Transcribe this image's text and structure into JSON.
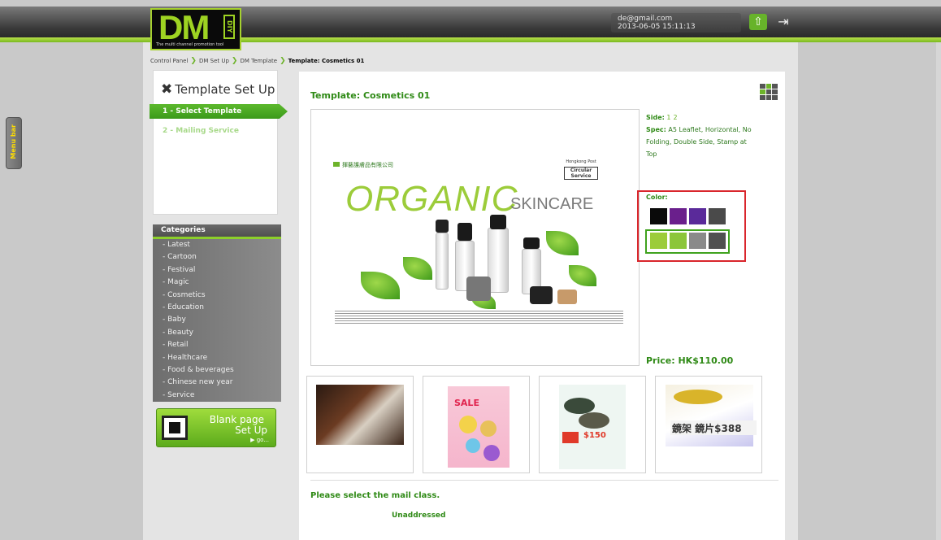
{
  "header": {
    "logo_main": "DM",
    "logo_sub": "DIY",
    "logo_tagline": "The multi channel promotion tool",
    "user_email": "de@gmail.com",
    "user_datetime": "2013-06-05 15:11:13",
    "home_icon": "up-arrow-icon",
    "logout_icon": "logout-icon"
  },
  "side_tab": {
    "label": "Menu bar"
  },
  "breadcrumb": [
    "Control Panel",
    "DM Set Up",
    "DM Template",
    "Template: Cosmetics 01"
  ],
  "setup": {
    "title": "Template Set Up",
    "icon": "tools-icon",
    "steps": [
      "1 - Select Template",
      "2 - Mailing Service"
    ]
  },
  "categories": {
    "title": "Categories",
    "items": [
      "Latest",
      "Cartoon",
      "Festival",
      "Magic",
      "Cosmetics",
      "Education",
      "Baby",
      "Beauty",
      "Retail",
      "Healthcare",
      "Food & beverages",
      "Chinese new year",
      "Service"
    ]
  },
  "blank_page": {
    "line1": "Blank page",
    "line2": "Set Up",
    "go": "go..."
  },
  "template": {
    "title": "Template: Cosmetics 01",
    "preview": {
      "company": "揮藝護膚品有限公司",
      "hkpost_top": "Hongkong Post",
      "hkpost_box": "Circular Service",
      "headline": "ORGANIC",
      "headline_sub": "SKINCARE"
    },
    "side_label": "Side:",
    "sides": [
      "1",
      "2"
    ],
    "spec_label": "Spec:",
    "spec_text": "A5 Leaflet, Horizontal, No Folding, Double Side, Stamp at Top",
    "color_label": "Color:",
    "color_rows": [
      [
        "#0a0a0a",
        "#6a1f8c",
        "#5a2a9a",
        "#4a4a4a"
      ],
      [
        "#9ccc3a",
        "#8cc63a",
        "#8a8a8a",
        "#505050"
      ]
    ],
    "price": "Price: HK$110.00"
  },
  "thumbnails": [
    {
      "name": "thumb-template-1",
      "text": ""
    },
    {
      "name": "thumb-template-2",
      "text": "SALE"
    },
    {
      "name": "thumb-template-3",
      "text": "$150"
    },
    {
      "name": "thumb-template-4",
      "text": "鏡架 鏡片$388"
    }
  ],
  "mail": {
    "question": "Please select the mail class.",
    "option": "Unaddressed"
  }
}
